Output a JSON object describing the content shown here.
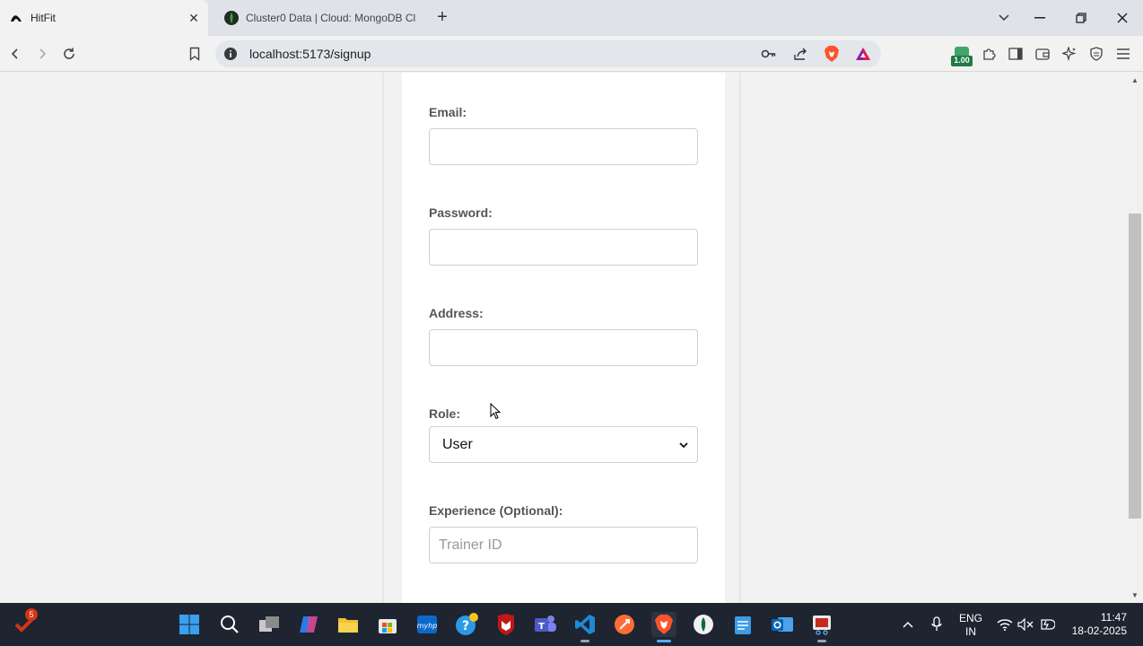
{
  "browser": {
    "tabs": [
      {
        "title": "HitFit",
        "active": true
      },
      {
        "title": "Cluster0 Data | Cloud: MongoDB Cl",
        "active": false
      }
    ],
    "url": "localhost:5173/signup",
    "extension_badge": "1.00"
  },
  "form": {
    "email_label": "Email:",
    "password_label": "Password:",
    "address_label": "Address:",
    "role_label": "Role:",
    "role_value": "User",
    "experience_label": "Experience (Optional):",
    "experience_placeholder": "Trainer ID"
  },
  "taskbar": {
    "notification_count": "5",
    "language_line1": "ENG",
    "language_line2": "IN",
    "time": "11:47",
    "date": "18-02-2025"
  },
  "colors": {
    "accent_brave": "#fb542b",
    "taskbar_bg": "#1e2430",
    "mongo_green": "#00684a"
  }
}
